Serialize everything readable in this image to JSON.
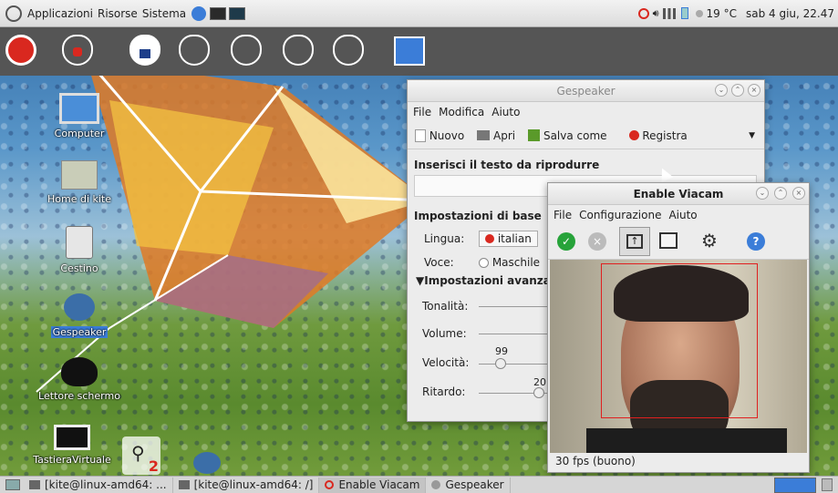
{
  "topbar": {
    "menus": [
      "Applicazioni",
      "Risorse",
      "Sistema"
    ],
    "temperature": "19 °C",
    "datetime": "sab 4 giu, 22.47"
  },
  "desktop": {
    "icons": [
      "Computer",
      "Home di kite",
      "Cestino",
      "Gespeaker",
      "Lettore schermo",
      "TastieraVirtuale"
    ],
    "badge": "2"
  },
  "gespeaker": {
    "title": "Gespeaker",
    "menu": [
      "File",
      "Modifica",
      "Aiuto"
    ],
    "toolbar": {
      "new": "Nuovo",
      "open": "Apri",
      "saveas": "Salva come",
      "record": "Registra"
    },
    "text_heading": "Inserisci il testo da riprodurre",
    "basic_heading": "Impostazioni di base",
    "language_label": "Lingua:",
    "language_value": "italian",
    "voice_label": "Voce:",
    "voice_value": "Maschile",
    "advanced_heading": "▼Impostazioni avanza",
    "pitch_label": "Tonalità:",
    "volume_label": "Volume:",
    "speed_label": "Velocità:",
    "speed_value": "99",
    "delay_label": "Ritardo:",
    "delay_value": "20"
  },
  "viacam": {
    "title": "Enable Viacam",
    "menu": [
      "File",
      "Configurazione",
      "Aiuto"
    ],
    "status": "30 fps (buono)"
  },
  "taskbar": {
    "tasks": [
      "[kite@linux-amd64: ...",
      "[kite@linux-amd64: /]",
      "Enable Viacam",
      "Gespeaker"
    ]
  },
  "colors": {
    "accent": "#3b7dd8",
    "red": "#d9281f",
    "green": "#27a33a"
  }
}
